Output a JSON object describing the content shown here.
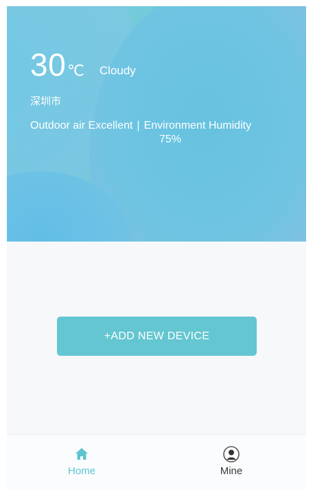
{
  "header": {
    "temperature": "30",
    "unit": "℃",
    "weather": "Cloudy",
    "city": "深圳市",
    "outdoor_air": "Outdoor air Excellent",
    "separator": "|",
    "humidity_label": "Environment Humidity",
    "humidity_value": "75%"
  },
  "main": {
    "add_device_label": "+ADD NEW DEVICE"
  },
  "bottom_nav": {
    "items": [
      {
        "label": "Home",
        "icon": "home-icon",
        "active": true
      },
      {
        "label": "Mine",
        "icon": "user-icon",
        "active": false
      }
    ]
  },
  "colors": {
    "accent": "#64c6d1",
    "nav_active": "#5cc6cf"
  }
}
